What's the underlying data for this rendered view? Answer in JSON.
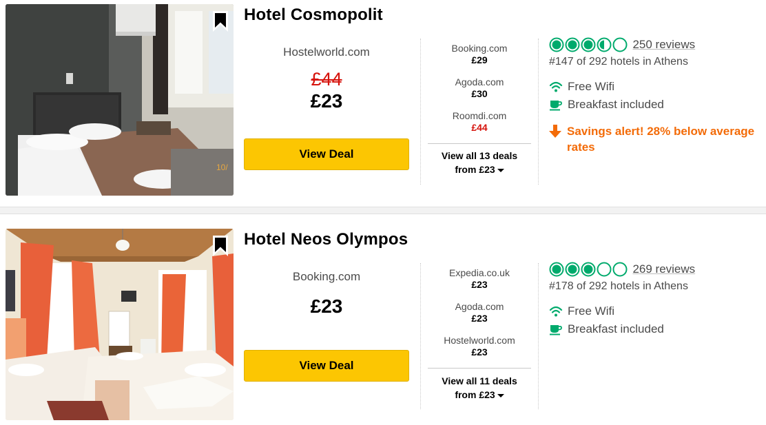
{
  "listings": [
    {
      "name": "Hotel Cosmopolit",
      "main_offer": {
        "provider": "Hostelworld.com",
        "strike_price": "£44",
        "price": "£23",
        "button_label": "View Deal"
      },
      "other_deals": [
        {
          "provider": "Booking.com",
          "price": "£29"
        },
        {
          "provider": "Agoda.com",
          "price": "£30"
        },
        {
          "provider": "Roomdi.com",
          "price": "£44"
        }
      ],
      "view_all_line1": "View all 13 deals",
      "view_all_line2": "from £23",
      "rating_bubbles": 3.5,
      "reviews": "250 reviews",
      "ranking": "#147 of 292 hotels in Athens",
      "amenities": [
        "Free Wifi",
        "Breakfast included"
      ],
      "savings_alert": "Savings alert! 28% below average rates",
      "photo_caption": "10/"
    },
    {
      "name": "Hotel Neos Olympos",
      "main_offer": {
        "provider": "Booking.com",
        "strike_price": "",
        "price": "£23",
        "button_label": "View Deal"
      },
      "other_deals": [
        {
          "provider": "Expedia.co.uk",
          "price": "£23"
        },
        {
          "provider": "Agoda.com",
          "price": "£23"
        },
        {
          "provider": "Hostelworld.com",
          "price": "£23"
        }
      ],
      "view_all_line1": "View all 11 deals",
      "view_all_line2": "from £23",
      "rating_bubbles": 3,
      "reviews": "269 reviews",
      "ranking": "#178 of 292 hotels in Athens",
      "amenities": [
        "Free Wifi",
        "Breakfast included"
      ]
    }
  ],
  "colors": {
    "accent_green": "#00aa6c",
    "deal_button": "#fcc602",
    "strike_red": "#d6130c",
    "savings_orange": "#f36b08"
  },
  "icons": {
    "bookmark": "bookmark-icon",
    "wifi": "wifi-icon",
    "breakfast": "coffee-cup-icon",
    "savings": "arrow-down-icon",
    "caret": "caret-down-icon"
  }
}
